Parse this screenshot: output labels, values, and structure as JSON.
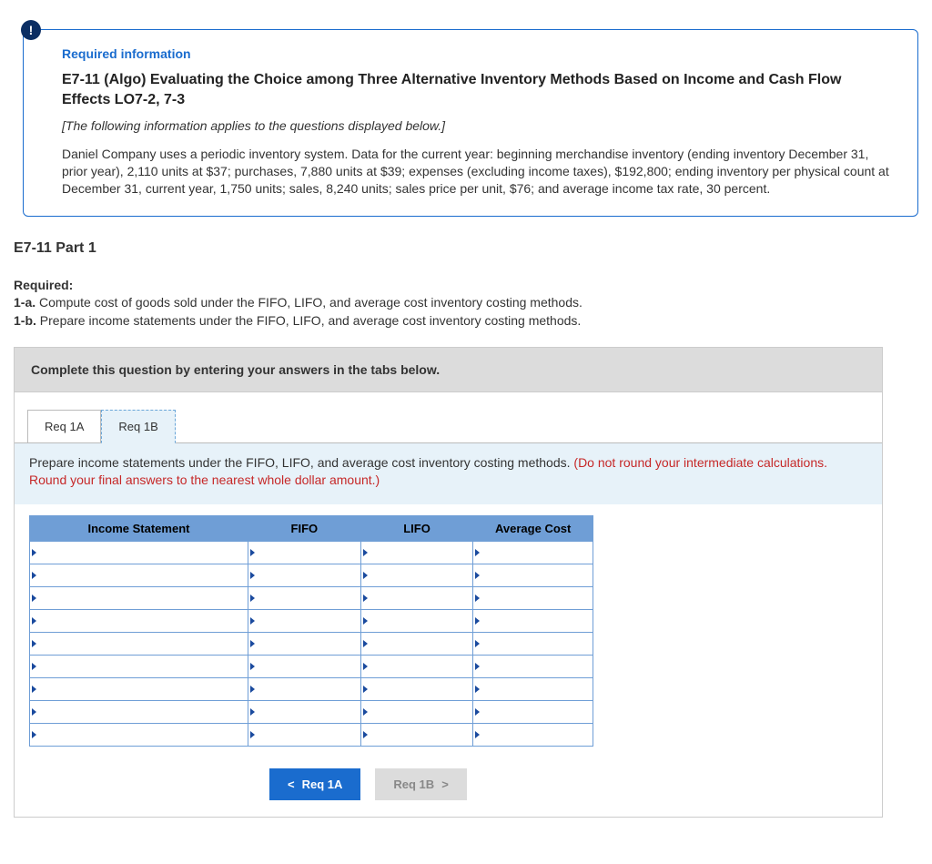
{
  "badge_text": "!",
  "required_info": "Required information",
  "exercise_title": "E7-11 (Algo) Evaluating the Choice among Three Alternative Inventory Methods Based on Income and Cash Flow Effects LO7-2, 7-3",
  "italic_note": "[The following information applies to the questions displayed below.]",
  "body_text": "Daniel Company uses a periodic inventory system. Data for the current year: beginning merchandise inventory (ending inventory December 31, prior year), 2,110 units at $37; purchases, 7,880 units at $39; expenses (excluding income taxes), $192,800; ending inventory per physical count at December 31, current year, 1,750 units; sales, 8,240 units; sales price per unit, $76; and average income tax rate, 30 percent.",
  "part_heading": "E7-11 Part 1",
  "required_label": "Required:",
  "req_1a_label": "1-a.",
  "req_1a_text": " Compute cost of goods sold under the FIFO, LIFO, and average cost inventory costing methods.",
  "req_1b_label": "1-b.",
  "req_1b_text": " Prepare income statements under the FIFO, LIFO, and average cost inventory costing methods.",
  "complete_banner": "Complete this question by entering your answers in the tabs below.",
  "tab_1a": "Req 1A",
  "tab_1b": "Req 1B",
  "directions_main": "Prepare income statements under the FIFO, LIFO, and average cost inventory costing methods. ",
  "directions_red": "(Do not round your intermediate calculations. Round your final answers to the nearest whole dollar amount.)",
  "col_income": "Income Statement",
  "col_fifo": "FIFO",
  "col_lifo": "LIFO",
  "col_avg": "Average Cost",
  "prev_btn": "Req 1A",
  "next_btn": "Req 1B"
}
